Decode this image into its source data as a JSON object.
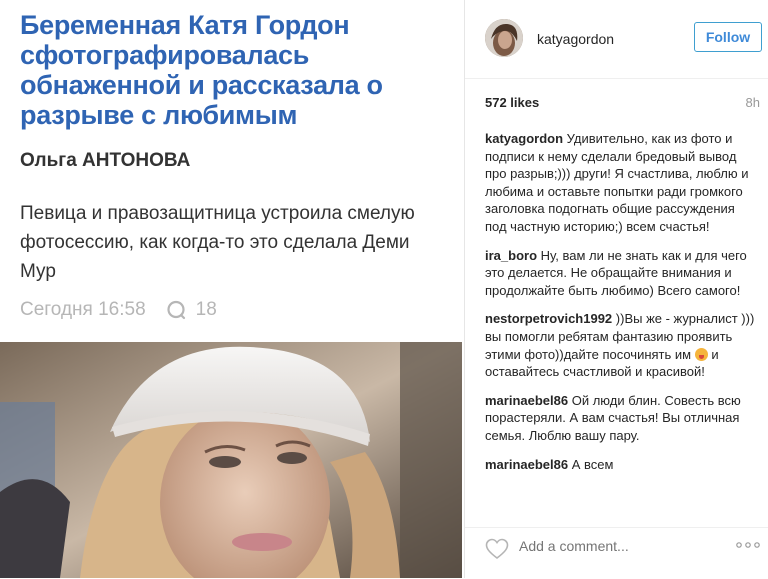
{
  "article": {
    "headline": "Беременная Катя Гордон сфотографировалась обнаженной и рассказала о разрыве с любимым",
    "author": "Ольга АНТОНОВА",
    "lead": "Певица и правозащитница устроила смелую фотосессию, как когда-то это сделала Деми Мур",
    "date": "Сегодня 16:58",
    "comment_count": "18"
  },
  "instagram": {
    "username": "katyagordon",
    "follow_label": "Follow",
    "likes": "572 likes",
    "time": "8h",
    "comments": [
      {
        "user": "katyagordon",
        "text": "Удивительно, как из фото и подписи к нему сделали бредовый вывод про разрыв;))) други! Я счастлива, люблю и любима и оставьте попытки ради громкого заголовка подогнать общие рассуждения под частную историю;) всем счастья!"
      },
      {
        "user": "ira_boro",
        "text": "Ну, вам ли не знать как и для чего это делается. Не обращайте внимания и продолжайте быть любимо) Всего самого!"
      },
      {
        "user": "nestorpetrovich1992",
        "text_before": "))Вы же - журналист ))) вы помогли ребятам фантазию проявить этими фото))дайте посочинять им",
        "text_after": " и оставайтесь счастливой и красивой!",
        "emoji": "tongue-out-emoji"
      },
      {
        "user": "marinaebel86",
        "text": "Ой люди блин. Совесть всю порастеряли. А вам счастья! Вы отличная семья. Люблю вашу пару."
      },
      {
        "user": "marinaebel86",
        "text": "А всем"
      }
    ],
    "add_comment_placeholder": "Add a comment...",
    "icons": {
      "heart": "heart-icon",
      "more": "more-options-icon",
      "comment": "comment-bubble-icon"
    },
    "colors": {
      "follow": "#3f8ad8",
      "headline": "#2f64b3"
    }
  }
}
